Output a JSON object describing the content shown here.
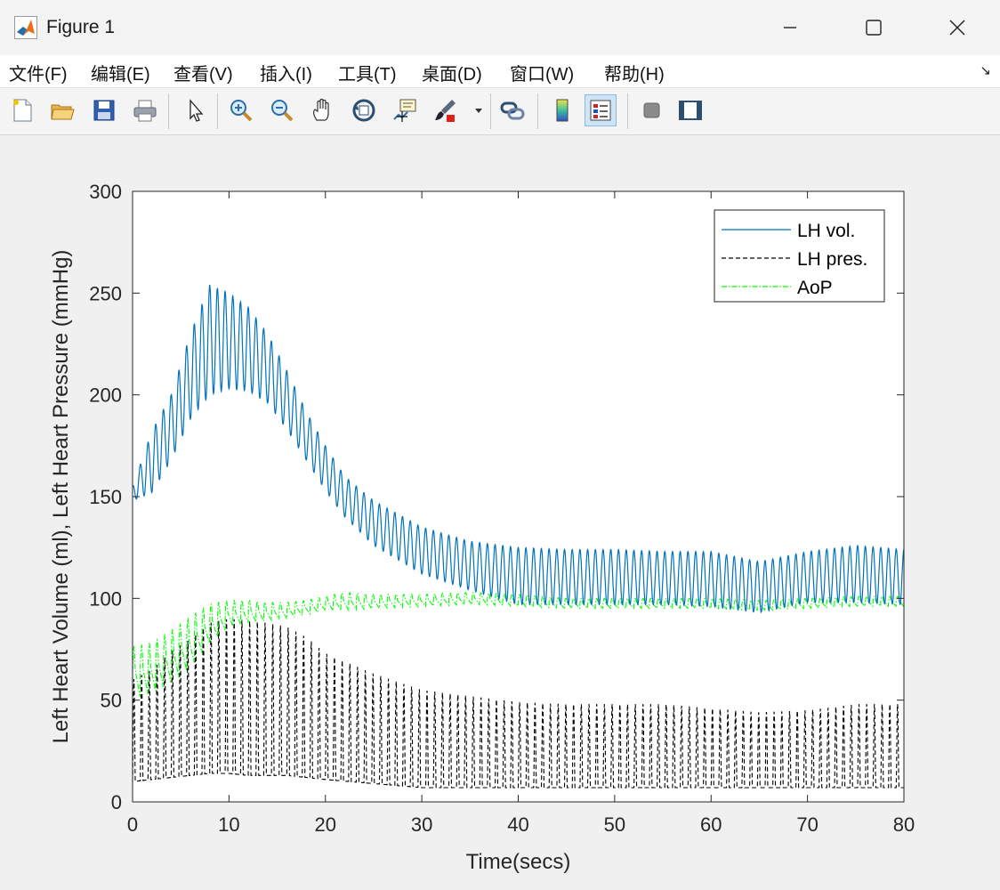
{
  "window": {
    "title": "Figure 1"
  },
  "menu": {
    "items": [
      "文件(F)",
      "编辑(E)",
      "查看(V)",
      "插入(I)",
      "工具(T)",
      "桌面(D)",
      "窗口(W)",
      "帮助(H)"
    ]
  },
  "toolbar": {
    "buttons": [
      "new-figure-icon",
      "open-file-icon",
      "save-icon",
      "print-icon",
      "edit-plot-icon",
      "zoom-in-icon",
      "zoom-out-icon",
      "pan-icon",
      "rotate-3d-icon",
      "data-cursor-icon",
      "brush-icon",
      "brush-dropdown-icon",
      "link-plot-icon",
      "colorbar-icon",
      "legend-icon",
      "hide-plot-tools-icon",
      "show-plot-tools-icon"
    ],
    "active": "legend-icon"
  },
  "colors": {
    "lh_vol": "#0072bd",
    "lh_pres": "#000000",
    "aop": "#00ff00"
  },
  "chart_data": {
    "type": "line",
    "title": "",
    "xlabel": "Time(secs)",
    "ylabel": "Left Heart Volume (ml), Left Heart Pressure (mmHg)",
    "xlim": [
      0,
      80
    ],
    "ylim": [
      0,
      300
    ],
    "xticks": [
      0,
      10,
      20,
      30,
      40,
      50,
      60,
      70,
      80
    ],
    "yticks": [
      0,
      50,
      100,
      150,
      200,
      250,
      300
    ],
    "grid": false,
    "legend": "top-right",
    "series": [
      {
        "name": "LH vol.",
        "style": "solid",
        "envelope_x": [
          0,
          2,
          4,
          6,
          8,
          10,
          12,
          14,
          16,
          18,
          20,
          22,
          25,
          30,
          35,
          40,
          45,
          50,
          55,
          60,
          65,
          70,
          75,
          80
        ],
        "upper": [
          155,
          182,
          200,
          230,
          254,
          250,
          243,
          230,
          212,
          192,
          175,
          160,
          148,
          135,
          128,
          125,
          124,
          124,
          123,
          123,
          118,
          123,
          126,
          124
        ],
        "lower": [
          148,
          152,
          168,
          188,
          200,
          203,
          202,
          196,
          183,
          168,
          153,
          140,
          126,
          112,
          104,
          97,
          97,
          97,
          97,
          96,
          93,
          98,
          98,
          97
        ]
      },
      {
        "name": "LH pres.",
        "style": "dashed",
        "envelope_x": [
          0,
          2,
          4,
          6,
          8,
          10,
          12,
          14,
          16,
          18,
          20,
          25,
          30,
          35,
          40,
          45,
          50,
          55,
          60,
          65,
          70,
          75,
          80
        ],
        "upper": [
          60,
          65,
          74,
          80,
          88,
          90,
          89,
          88,
          86,
          81,
          73,
          63,
          55,
          52,
          49,
          48,
          48,
          48,
          46,
          44,
          45,
          48,
          48
        ],
        "lower": [
          10,
          11,
          12,
          13,
          14,
          14,
          13,
          13,
          13,
          12,
          11,
          9,
          7,
          7,
          7,
          7,
          7,
          7,
          7,
          7,
          7,
          7,
          7
        ]
      },
      {
        "name": "AoP",
        "style": "dashdot",
        "envelope_x": [
          0,
          2,
          4,
          6,
          8,
          10,
          12,
          14,
          16,
          18,
          20,
          22,
          25,
          30,
          35,
          40,
          45,
          50,
          55,
          60,
          65,
          70,
          75,
          80
        ],
        "upper": [
          76,
          78,
          84,
          91,
          97,
          99,
          99,
          98,
          98,
          99,
          101,
          103,
          102,
          102,
          103,
          102,
          100,
          100,
          100,
          100,
          99,
          100,
          101,
          101
        ],
        "lower": [
          50,
          53,
          58,
          66,
          78,
          86,
          88,
          89,
          90,
          92,
          94,
          94,
          95,
          96,
          97,
          96,
          95,
          95,
          95,
          95,
          94,
          95,
          96,
          96
        ]
      }
    ]
  }
}
